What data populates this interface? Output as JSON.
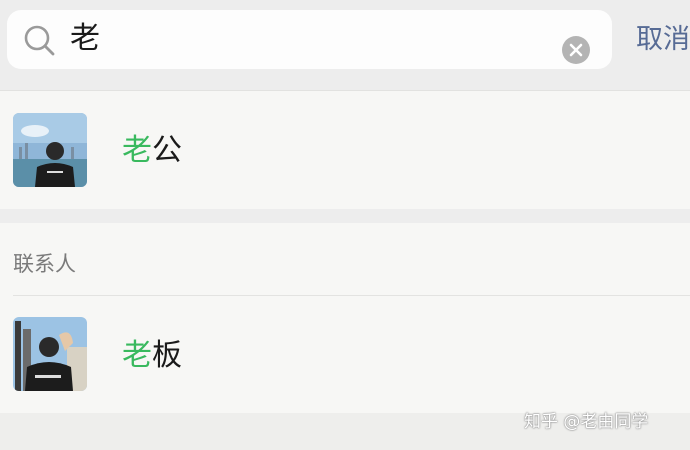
{
  "search": {
    "query": "老",
    "cancel_label": "取消"
  },
  "results": {
    "top_hit": {
      "name_highlight": "老",
      "name_rest": "公"
    },
    "contacts_section": {
      "label": "联系人",
      "items": [
        {
          "name_highlight": "老",
          "name_rest": "板"
        }
      ]
    }
  },
  "watermark": "知乎 @老由同学",
  "colors": {
    "highlight": "#39b95e",
    "link": "#576b95"
  }
}
